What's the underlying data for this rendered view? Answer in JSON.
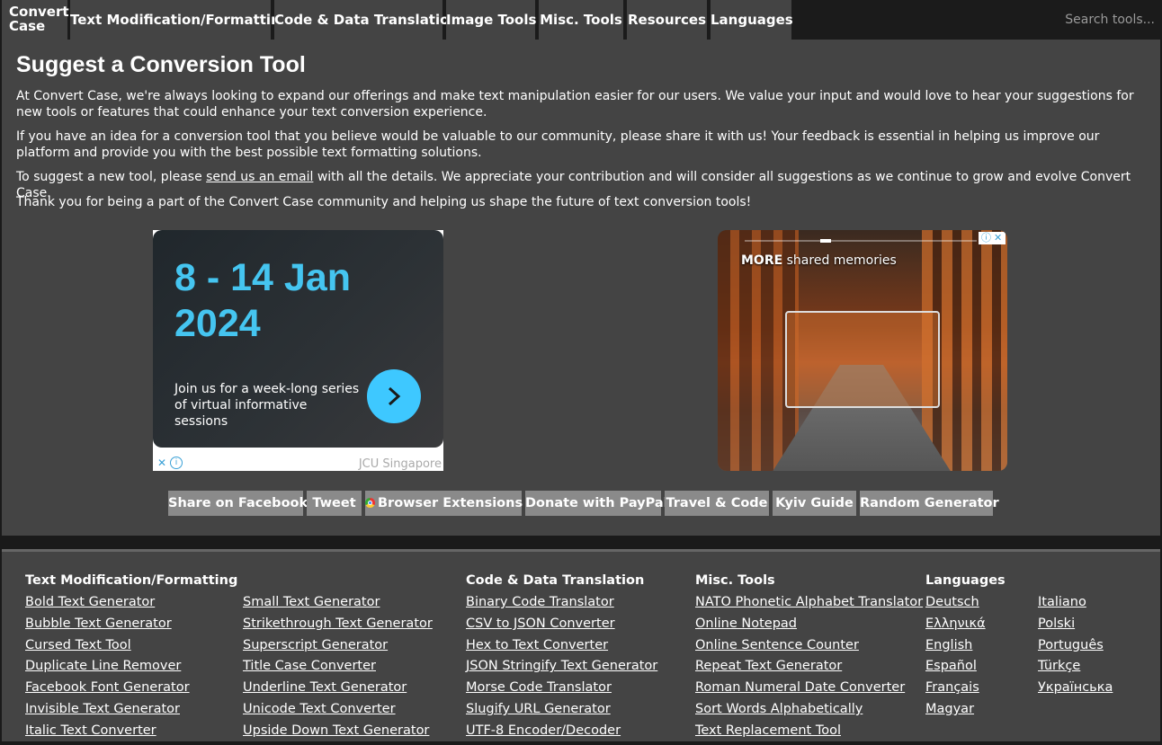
{
  "nav": {
    "brand_line1": "Convert",
    "brand_line2": "Case",
    "items": [
      "Text Modification/Formatting",
      "Code & Data Translation",
      "Image Tools",
      "Misc. Tools",
      "Resources",
      "Languages"
    ],
    "search_placeholder": "Search tools..."
  },
  "main": {
    "title": "Suggest a Conversion Tool",
    "p1": "At Convert Case, we're always looking to expand our offerings and make text manipulation easier for our users. We value your input and would love to hear your suggestions for new tools or features that could enhance your text conversion experience.",
    "p2": "If you have an idea for a conversion tool that you believe would be valuable to our community, please share it with us! Your feedback is essential in helping us improve our platform and provide you with the best possible text formatting solutions.",
    "p3_before": "To suggest a new tool, please ",
    "p3_link": "send us an email",
    "p3_after": " with all the details. We appreciate your contribution and will consider all suggestions as we continue to grow and evolve Convert Case.",
    "p4": "Thank you for being a part of the Convert Case community and helping us shape the future of text conversion tools!"
  },
  "ad_left": {
    "date_line1": "8 - 14 Jan",
    "date_line2": "2024",
    "subtitle": "Join us for a week-long series of virtual informative sessions",
    "brand": "JCU Singapore"
  },
  "ad_right": {
    "caption_bold": "MORE",
    "caption_rest": " shared memories"
  },
  "buttons": [
    "Share on Facebook",
    "Tweet",
    "Browser Extensions",
    "Donate with PayPal",
    "Travel & Code",
    "Kyiv Guide",
    "Random Generator"
  ],
  "footer": {
    "col1": {
      "heading": "Text Modification/Formatting",
      "links": [
        "Bold Text Generator",
        "Bubble Text Generator",
        "Cursed Text Tool",
        "Duplicate Line Remover",
        "Facebook Font Generator",
        "Invisible Text Generator",
        "Italic Text Converter"
      ]
    },
    "col2": {
      "links": [
        "Small Text Generator",
        "Strikethrough Text Generator",
        "Superscript Generator",
        "Title Case Converter",
        "Underline Text Generator",
        "Unicode Text Converter",
        "Upside Down Text Generator"
      ]
    },
    "col3": {
      "heading": "Code & Data Translation",
      "links": [
        "Binary Code Translator",
        "CSV to JSON Converter",
        "Hex to Text Converter",
        "JSON Stringify Text Generator",
        "Morse Code Translator",
        "Slugify URL Generator",
        "UTF-8 Encoder/Decoder"
      ]
    },
    "col4": {
      "heading": "Misc. Tools",
      "links": [
        "NATO Phonetic Alphabet Translator",
        "Online Notepad",
        "Online Sentence Counter",
        "Repeat Text Generator",
        "Roman Numeral Date Converter",
        "Sort Words Alphabetically",
        "Text Replacement Tool"
      ]
    },
    "col5": {
      "heading": "Languages",
      "links": [
        "Deutsch",
        "Ελληνικά",
        "English",
        "Español",
        "Français",
        "Magyar"
      ]
    },
    "col6": {
      "links": [
        "Italiano",
        "Polski",
        "Português",
        "Türkçe",
        "Українська"
      ]
    }
  }
}
